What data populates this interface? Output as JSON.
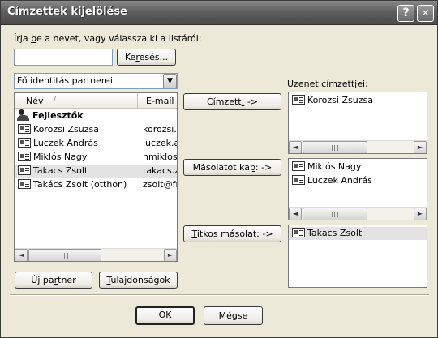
{
  "window": {
    "title": "Címzettek kijelölése",
    "help_glyph": "?",
    "close_glyph": "✕"
  },
  "search": {
    "instruction_prefix": "Írja ",
    "instruction_accel": "b",
    "instruction_suffix": "e a nevet, vagy válassza ki a listáról:",
    "input_value": "",
    "button_prefix": "Ke",
    "button_accel": "r",
    "button_suffix": "esés..."
  },
  "addressbook": {
    "selected": "Fő identitás partnerei"
  },
  "contacts": {
    "columns": {
      "name": "Név",
      "sort_glyph": "∕",
      "email": "E-mail c"
    },
    "rows": [
      {
        "name": "Fejlesztők",
        "email": "",
        "icon": "group-icon",
        "bold": true
      },
      {
        "name": "Korozsi Zsuzsa",
        "email": "korozsi.z",
        "icon": "contact-card-icon"
      },
      {
        "name": "Luczek András",
        "email": "luczek.a",
        "icon": "contact-card-icon"
      },
      {
        "name": "Miklós Nagy",
        "email": "nmiklos@",
        "icon": "contact-card-icon"
      },
      {
        "name": "Takacs Zsolt",
        "email": "takacs.z",
        "icon": "contact-card-icon",
        "selected": true
      },
      {
        "name": "Takács Zsolt (otthon)",
        "email": "zsolt@fre",
        "icon": "contact-card-icon"
      }
    ]
  },
  "buttons": {
    "to_prefix": "Címzett",
    "to_accel": ":",
    "to_suffix": " ->",
    "cc_prefix": "Másolatot ka",
    "cc_accel": "p",
    "cc_suffix": ": ->",
    "bcc_prefix": "",
    "bcc_accel": "T",
    "bcc_suffix": "itkos másolat: ->",
    "new_contact_prefix": "Új pa",
    "new_contact_accel": "r",
    "new_contact_suffix": "tner",
    "properties_prefix": "",
    "properties_accel": "T",
    "properties_suffix": "ulajdonságok",
    "ok": "OK",
    "cancel": "Mégse"
  },
  "recipients": {
    "label_prefix": "",
    "label_accel": "Ü",
    "label_suffix": "zenet címzettjei:",
    "to": [
      "Korozsi Zsuzsa"
    ],
    "cc": [
      "Miklós Nagy",
      "Luczek András"
    ],
    "bcc": [
      "Takacs Zsolt"
    ]
  },
  "scroll_arrows": {
    "left": "◄",
    "right": "►"
  },
  "colors": {
    "title_bar": "#5e5e5e",
    "selection": "#e3e3e3",
    "dialog_bg": "#ece9d8"
  }
}
